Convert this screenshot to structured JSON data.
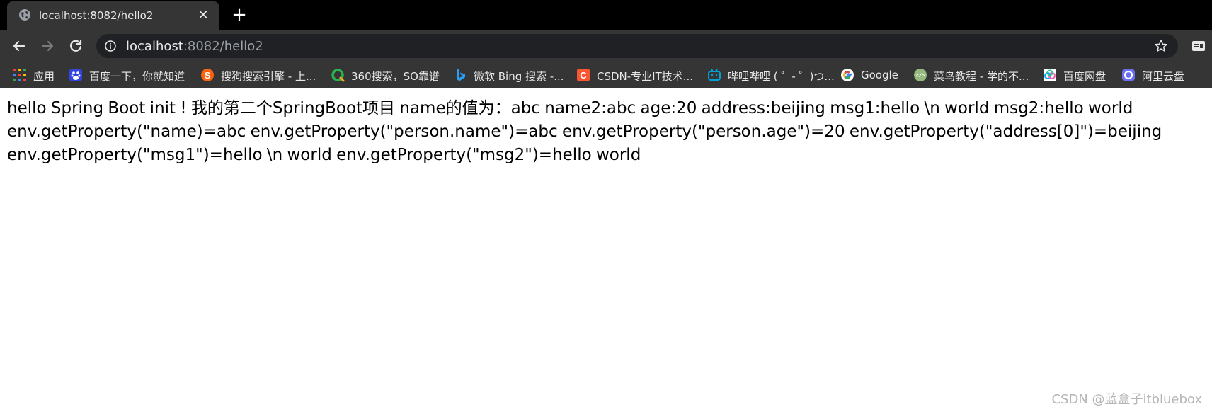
{
  "tab": {
    "title": "localhost:8082/hello2",
    "favicon": "globe-icon",
    "close_icon": "close-icon",
    "new_tab_icon": "plus-icon"
  },
  "toolbar": {
    "back_icon": "back-arrow-icon",
    "forward_icon": "forward-arrow-icon",
    "reload_icon": "reload-icon",
    "url_host": "localhost",
    "url_rest": ":8082/hello2",
    "info_icon": "info-icon",
    "bookmark_star_icon": "star-icon",
    "extension_icon": "reading-list-icon"
  },
  "bookmarks": [
    {
      "label": "应用",
      "icon": "apps-grid-icon"
    },
    {
      "label": "百度一下，你就知道",
      "icon": "baidu-icon"
    },
    {
      "label": "搜狗搜索引擎 - 上...",
      "icon": "sogou-icon"
    },
    {
      "label": "360搜索，SO靠谱",
      "icon": "360-icon"
    },
    {
      "label": "微软 Bing 搜索 -...",
      "icon": "bing-icon"
    },
    {
      "label": "CSDN-专业IT技术...",
      "icon": "csdn-icon"
    },
    {
      "label": "哔哩哔哩 ( ゜- ゜)つ...",
      "icon": "bilibili-icon"
    },
    {
      "label": "Google",
      "icon": "google-icon"
    },
    {
      "label": "菜鸟教程 - 学的不...",
      "icon": "runoob-icon"
    },
    {
      "label": "百度网盘",
      "icon": "baidu-netdisk-icon"
    },
    {
      "label": "阿里云盘",
      "icon": "aliyun-drive-icon"
    }
  ],
  "page": {
    "body_text": "hello Spring Boot init ! 我的第二个SpringBoot项目 name的值为：abc name2:abc age:20 address:beijing msg1:hello \\n world msg2:hello world env.getProperty(\"name)=abc env.getProperty(\"person.name\")=abc env.getProperty(\"person.age\")=20 env.getProperty(\"address[0]\")=beijing env.getProperty(\"msg1\")=hello \\n world env.getProperty(\"msg2\")=hello world"
  },
  "watermark": "CSDN @蓝盒子itbluebox",
  "colors": {
    "tabstrip_bg": "#000000",
    "toolbar_bg": "#353535",
    "omnibox_bg": "#202124",
    "page_bg": "#ffffff"
  }
}
